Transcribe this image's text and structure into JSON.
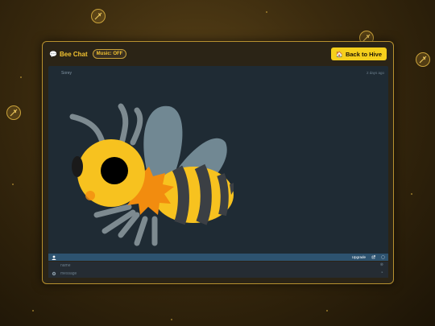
{
  "header": {
    "chat_icon": "speech-bubble-icon",
    "title": "Bee Chat",
    "music_label": "Music: OFF",
    "back_label": "Back to Hive",
    "back_icon": "house-icon"
  },
  "message": {
    "author": "Sorey",
    "time": "2 days ago",
    "image": "bee-emoji"
  },
  "toolbar": {
    "user_icon": "user-icon",
    "upgrade_label": "Upgrade",
    "external_icon": "external-link-icon",
    "info_icon": "info-icon"
  },
  "inputs": {
    "name_placeholder": "name",
    "message_placeholder": "message",
    "settings_icon": "gear-icon"
  },
  "colors": {
    "accent": "#f5cf1c",
    "title": "#f2c230",
    "panel_border": "#b8912f",
    "chat_bg": "#1f2b34",
    "toolbar": "#2d5370"
  }
}
